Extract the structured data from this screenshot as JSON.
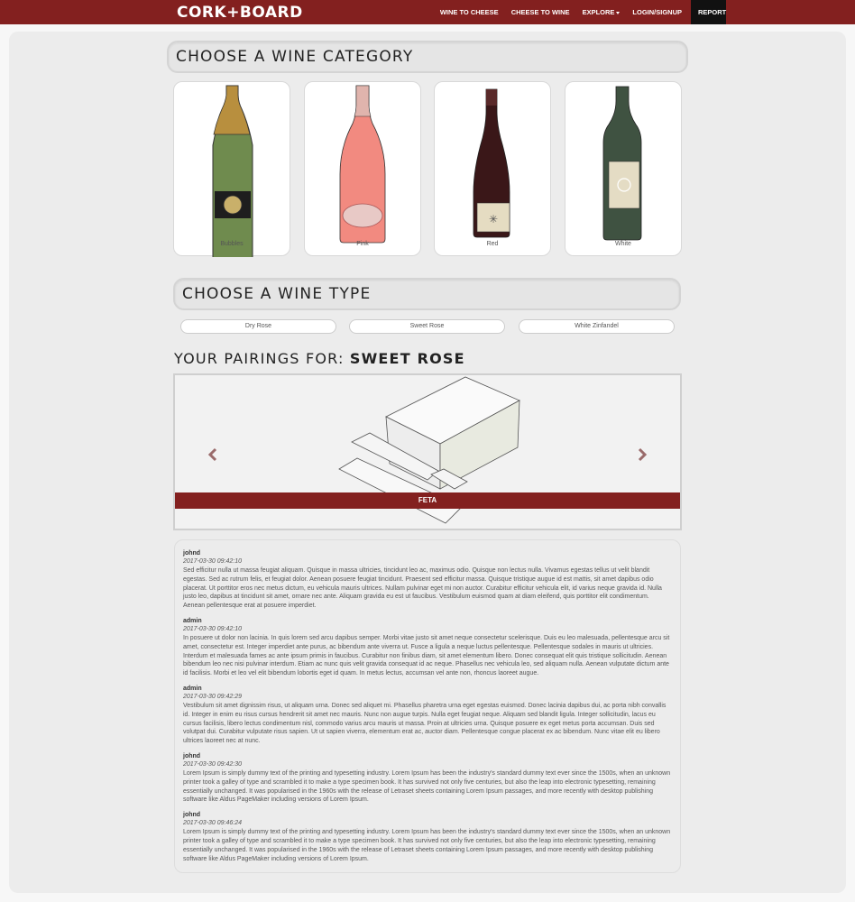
{
  "nav": {
    "brand": "CORK+BOARD",
    "items": [
      "WINE TO CHEESE",
      "CHEESE TO WINE",
      "EXPLORE",
      "LOGIN/SIGNUP"
    ],
    "report": "REPORT"
  },
  "category_section": {
    "title": "CHOOSE A WINE CATEGORY",
    "categories": [
      {
        "label": "Bubbles",
        "icon": "bubbles-bottle-icon"
      },
      {
        "label": "Pink",
        "icon": "pink-bottle-icon"
      },
      {
        "label": "Red",
        "icon": "red-bottle-icon"
      },
      {
        "label": "White",
        "icon": "white-bottle-icon"
      }
    ]
  },
  "type_section": {
    "title": "CHOOSE A WINE TYPE",
    "types": [
      "Dry Rose",
      "Sweet Rose",
      "White Zinfandel"
    ]
  },
  "pairings": {
    "prefix": "YOUR PAIRINGS FOR:",
    "selected": "SWEET ROSE",
    "carousel": {
      "current_item": "FETA",
      "image_icon": "feta-cheese-icon",
      "prev_icon": "chevron-left-icon",
      "next_icon": "chevron-right-icon"
    }
  },
  "comments": [
    {
      "user": "johnd",
      "time": "2017-03-30 09:42:10",
      "text": "Sed efficitur nulla ut massa feugiat aliquam. Quisque in massa ultricies, tincidunt leo ac, maximus odio. Quisque non lectus nulla. Vivamus egestas tellus ut velit blandit egestas. Sed ac rutrum felis, et feugiat dolor. Aenean posuere feugiat tincidunt. Praesent sed efficitur massa. Quisque tristique augue id est mattis, sit amet dapibus odio placerat. Ut porttitor eros nec metus dictum, eu vehicula mauris ultrices. Nullam pulvinar eget mi non auctor. Curabitur efficitur vehicula elit, id varius neque gravida id. Nulla justo leo, dapibus at tincidunt sit amet, ornare nec ante. Aliquam gravida eu est ut faucibus. Vestibulum euismod quam at diam eleifend, quis porttitor elit condimentum. Aenean pellentesque erat at posuere imperdiet."
    },
    {
      "user": "admin",
      "time": "2017-03-30 09:42:10",
      "text": "In posuere ut dolor non lacinia. In quis lorem sed arcu dapibus semper. Morbi vitae justo sit amet neque consectetur scelerisque. Duis eu leo malesuada, pellentesque arcu sit amet, consectetur est. Integer imperdiet ante purus, ac bibendum ante viverra ut. Fusce a ligula a neque luctus pellentesque. Pellentesque sodales in mauris ut ultricies. Interdum et malesuada fames ac ante ipsum primis in faucibus. Curabitur non finibus diam, sit amet elementum libero. Donec consequat elit quis tristique sollicitudin. Aenean bibendum leo nec nisi pulvinar interdum. Etiam ac nunc quis velit gravida consequat id ac neque. Phasellus nec vehicula leo, sed aliquam nulla. Aenean vulputate dictum ante id facilisis. Morbi et leo vel elit bibendum lobortis eget id quam. In metus lectus, accumsan vel ante non, rhoncus laoreet augue."
    },
    {
      "user": "admin",
      "time": "2017-03-30 09:42:29",
      "text": "Vestibulum sit amet dignissim risus, ut aliquam urna. Donec sed aliquet mi. Phasellus pharetra urna eget egestas euismod. Donec lacinia dapibus dui, ac porta nibh convallis id. Integer in enim eu risus cursus hendrerit sit amet nec mauris. Nunc non augue turpis. Nulla eget feugiat neque. Aliquam sed blandit ligula. Integer sollicitudin, lacus eu cursus facilisis, libero lectus condimentum nisl, commodo varius arcu mauris ut massa. Proin at ultricies urna. Quisque posuere ex eget metus porta accumsan. Duis sed volutpat dui. Curabitur vulputate risus sapien. Ut ut sapien viverra, elementum erat ac, auctor diam. Pellentesque congue placerat ex ac bibendum. Nunc vitae elit eu libero ultrices laoreet nec at nunc."
    },
    {
      "user": "johnd",
      "time": "2017-03-30 09:42:30",
      "text": "Lorem Ipsum is simply dummy text of the printing and typesetting industry. Lorem Ipsum has been the industry's standard dummy text ever since the 1500s, when an unknown printer took a galley of type and scrambled it to make a type specimen book. It has survived not only five centuries, but also the leap into electronic typesetting, remaining essentially unchanged. It was popularised in the 1960s with the release of Letraset sheets containing Lorem Ipsum passages, and more recently with desktop publishing software like Aldus PageMaker including versions of Lorem Ipsum."
    },
    {
      "user": "johnd",
      "time": "2017-03-30 09:46:24",
      "text": "Lorem Ipsum is simply dummy text of the printing and typesetting industry. Lorem Ipsum has been the industry's standard dummy text ever since the 1500s, when an unknown printer took a galley of type and scrambled it to make a type specimen book. It has survived not only five centuries, but also the leap into electronic typesetting, remaining essentially unchanged. It was popularised in the 1960s with the release of Letraset sheets containing Lorem Ipsum passages, and more recently with desktop publishing software like Aldus PageMaker including versions of Lorem Ipsum."
    }
  ],
  "colors": {
    "brand": "#83201f",
    "report_bg": "#111111",
    "panel": "#ececec"
  }
}
